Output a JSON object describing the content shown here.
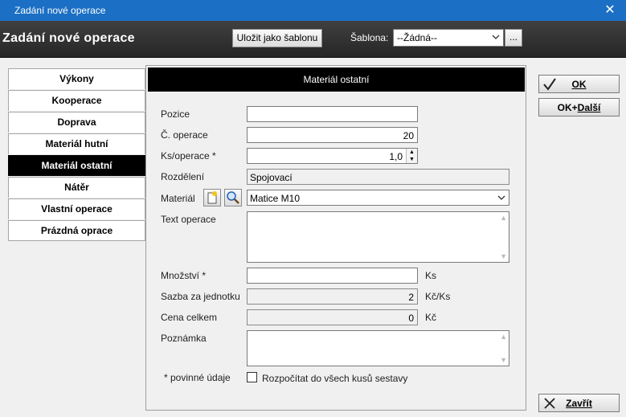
{
  "window": {
    "title": "Zadání nové operace",
    "close_glyph": "✕"
  },
  "header": {
    "title": "Zadání nové operace",
    "save_template_label": "Uložit jako šablonu",
    "template_label": "Šablona:",
    "template_value": "--Žádná--",
    "template_more": "..."
  },
  "nav": {
    "items": [
      {
        "label": "Výkony"
      },
      {
        "label": "Kooperace"
      },
      {
        "label": "Doprava"
      },
      {
        "label": "Materiál hutní"
      },
      {
        "label": "Materiál ostatní",
        "active": true
      },
      {
        "label": "Nátěr"
      },
      {
        "label": "Vlastní operace"
      },
      {
        "label": "Prázdná oprace"
      }
    ]
  },
  "panel": {
    "title": "Materiál ostatní",
    "pozice": {
      "label": "Pozice",
      "value": ""
    },
    "c_operace": {
      "label": "Č. operace",
      "value": "20"
    },
    "ks_operace": {
      "label": "Ks/operace *",
      "value": "1,0"
    },
    "rozdeleni": {
      "label": "Rozdělení",
      "value": "Spojovací"
    },
    "material": {
      "label": "Materiál",
      "value": "Matice M10"
    },
    "text_operace": {
      "label": "Text operace",
      "value": ""
    },
    "mnozstvi": {
      "label": "Množství *",
      "value": "",
      "unit": "Ks"
    },
    "sazba": {
      "label": "Sazba za jednotku",
      "value": "2",
      "unit": "Kč/Ks"
    },
    "cena": {
      "label": "Cena celkem",
      "value": "0",
      "unit": "Kč"
    },
    "poznamka": {
      "label": "Poznámka",
      "value": ""
    },
    "required_note": "* povinné údaje",
    "distribute_label": "Rozpočítat do všech kusů sestavy",
    "distribute_checked": false
  },
  "actions": {
    "ok": "OK",
    "ok_next_prefix": "OK+",
    "ok_next_suffix": "Další",
    "close": "Zavřít"
  },
  "colors": {
    "titlebar": "#1b6fc4",
    "header_bg": "#333333",
    "active_nav": "#000000"
  }
}
